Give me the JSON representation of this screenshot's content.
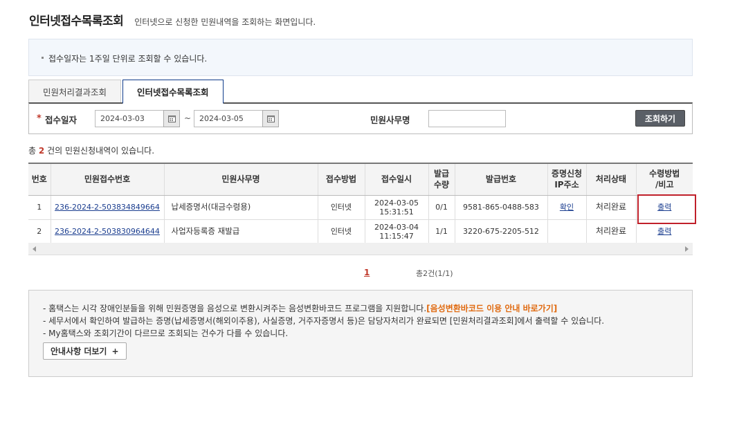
{
  "header": {
    "title": "인터넷접수목록조회",
    "description": "인터넷으로 신청한 민원내역을 조회하는 화면입니다."
  },
  "notice": "접수일자는 1주일 단위로 조회할 수 있습니다.",
  "tabs": [
    {
      "label": "민원처리결과조회",
      "active": false
    },
    {
      "label": "인터넷접수목록조회",
      "active": true
    }
  ],
  "search": {
    "required_mark": "*",
    "date_label": "접수일자",
    "date_from": "2024-03-03",
    "date_to": "2024-03-05",
    "range_separator": "~",
    "office_label": "민원사무명",
    "office_value": "",
    "button_label": "조회하기"
  },
  "result": {
    "prefix": "총",
    "count": "2",
    "suffix": "건의 민원신청내역이 있습니다."
  },
  "table": {
    "headers": [
      "번호",
      "민원접수번호",
      "민원사무명",
      "접수방법",
      "접수일시",
      "발급\n수량",
      "발급번호",
      "증명신청\nIP주소",
      "처리상태",
      "수령방법\n/비고"
    ],
    "rows": [
      {
        "no": "1",
        "receipt_no": "236-2024-2-503834849664",
        "office": "납세증명서(대금수령용)",
        "method": "인터넷",
        "date": "2024-03-05",
        "time": "15:31:51",
        "qty": "0/1",
        "issue_no": "9581-865-0488-583",
        "ip": "확인",
        "status": "처리완료",
        "receive": "출력"
      },
      {
        "no": "2",
        "receipt_no": "236-2024-2-503830964644",
        "office": "사업자등록증 재발급",
        "method": "인터넷",
        "date": "2024-03-04",
        "time": "11:15:47",
        "qty": "1/1",
        "issue_no": "3220-675-2205-512",
        "ip": "",
        "status": "처리완료",
        "receive": "출력"
      }
    ]
  },
  "pagination": {
    "current": "1",
    "total_text": "총2건(1/1)"
  },
  "info": {
    "line1": "- 홈택스는 시각 장애인분들을 위해 민원증명을 음성으로 변환시켜주는 음성변환바코드 프로그램을 지원합니다.",
    "line1_link": "[음성변환바코드 이용 안내 바로가기]",
    "line2": "- 세무서에서 확인하여 발급하는 증명(납세증명서(해외이주용), 사실증명, 거주자증명서 등)은 담당자처리가 완료되면 [민원처리결과조회]에서 출력할 수 있습니다.",
    "line3": "- My홈택스와 조회기간이 다르므로 조회되는 건수가 다를 수 있습니다.",
    "more_label": "안내사항 더보기",
    "more_icon": "+"
  },
  "colors": {
    "accent_red": "#c0392b",
    "link_blue": "#1a3d8f",
    "orange": "#e06a10",
    "tab_active_border": "#0d3a8a"
  }
}
